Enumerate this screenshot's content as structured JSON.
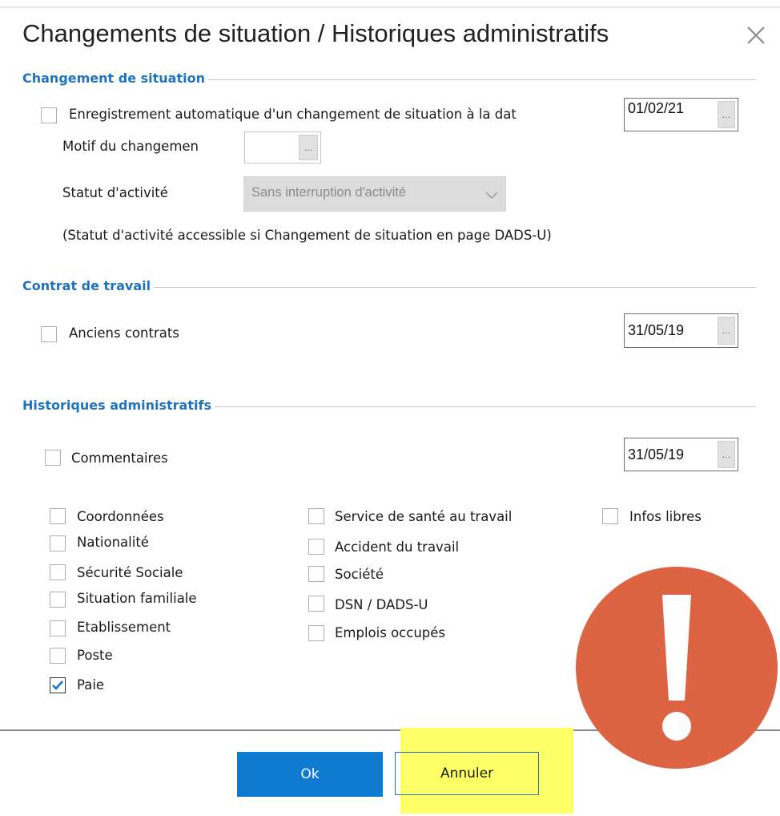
{
  "dialog": {
    "title": "Changements de situation / Historiques administratifs"
  },
  "changement": {
    "heading": "Changement de situation",
    "auto_label": "Enregistrement automatique d'un changement de situation à la dat",
    "auto_checked": false,
    "date": "01/02/21",
    "motif_label": "Motif du changemen",
    "motif_value": "",
    "statut_label": "Statut d'activité",
    "statut_value": "Sans interruption d'activité",
    "note": "(Statut d'activité accessible si Changement de situation en page DADS-U)"
  },
  "contrat": {
    "heading": "Contrat de travail",
    "anciens_label": "Anciens contrats",
    "anciens_checked": false,
    "date": "31/05/19"
  },
  "historiques": {
    "heading": "Historiques administratifs",
    "commentaires_label": "Commentaires",
    "commentaires_checked": false,
    "date": "31/05/19",
    "col1": [
      {
        "label": "Coordonnées",
        "checked": false
      },
      {
        "label": "Nationalité",
        "checked": false
      },
      {
        "label": "Sécurité Sociale",
        "checked": false
      },
      {
        "label": "Situation familiale",
        "checked": false
      },
      {
        "label": "Etablissement",
        "checked": false
      },
      {
        "label": "Poste",
        "checked": false
      },
      {
        "label": "Paie",
        "checked": true
      }
    ],
    "col2": [
      {
        "label": "Service de santé au travail",
        "checked": false
      },
      {
        "label": "Accident du travail",
        "checked": false
      },
      {
        "label": "Société",
        "checked": false
      },
      {
        "label": "DSN / DADS-U",
        "checked": false
      },
      {
        "label": "Emplois occupés",
        "checked": false
      }
    ],
    "col3": [
      {
        "label": "Infos libres",
        "checked": false
      }
    ]
  },
  "buttons": {
    "ok": "Ok",
    "cancel": "Annuler",
    "dots": "..."
  },
  "icons": {
    "close": "close-icon",
    "check": "check-icon",
    "warning": "exclamation-icon",
    "dropdown": "chevron-down-icon"
  },
  "colors": {
    "accent": "#1e73be",
    "ok_button": "#0f7bd0",
    "highlight": "#ffff66",
    "warning": "#dd6443"
  }
}
